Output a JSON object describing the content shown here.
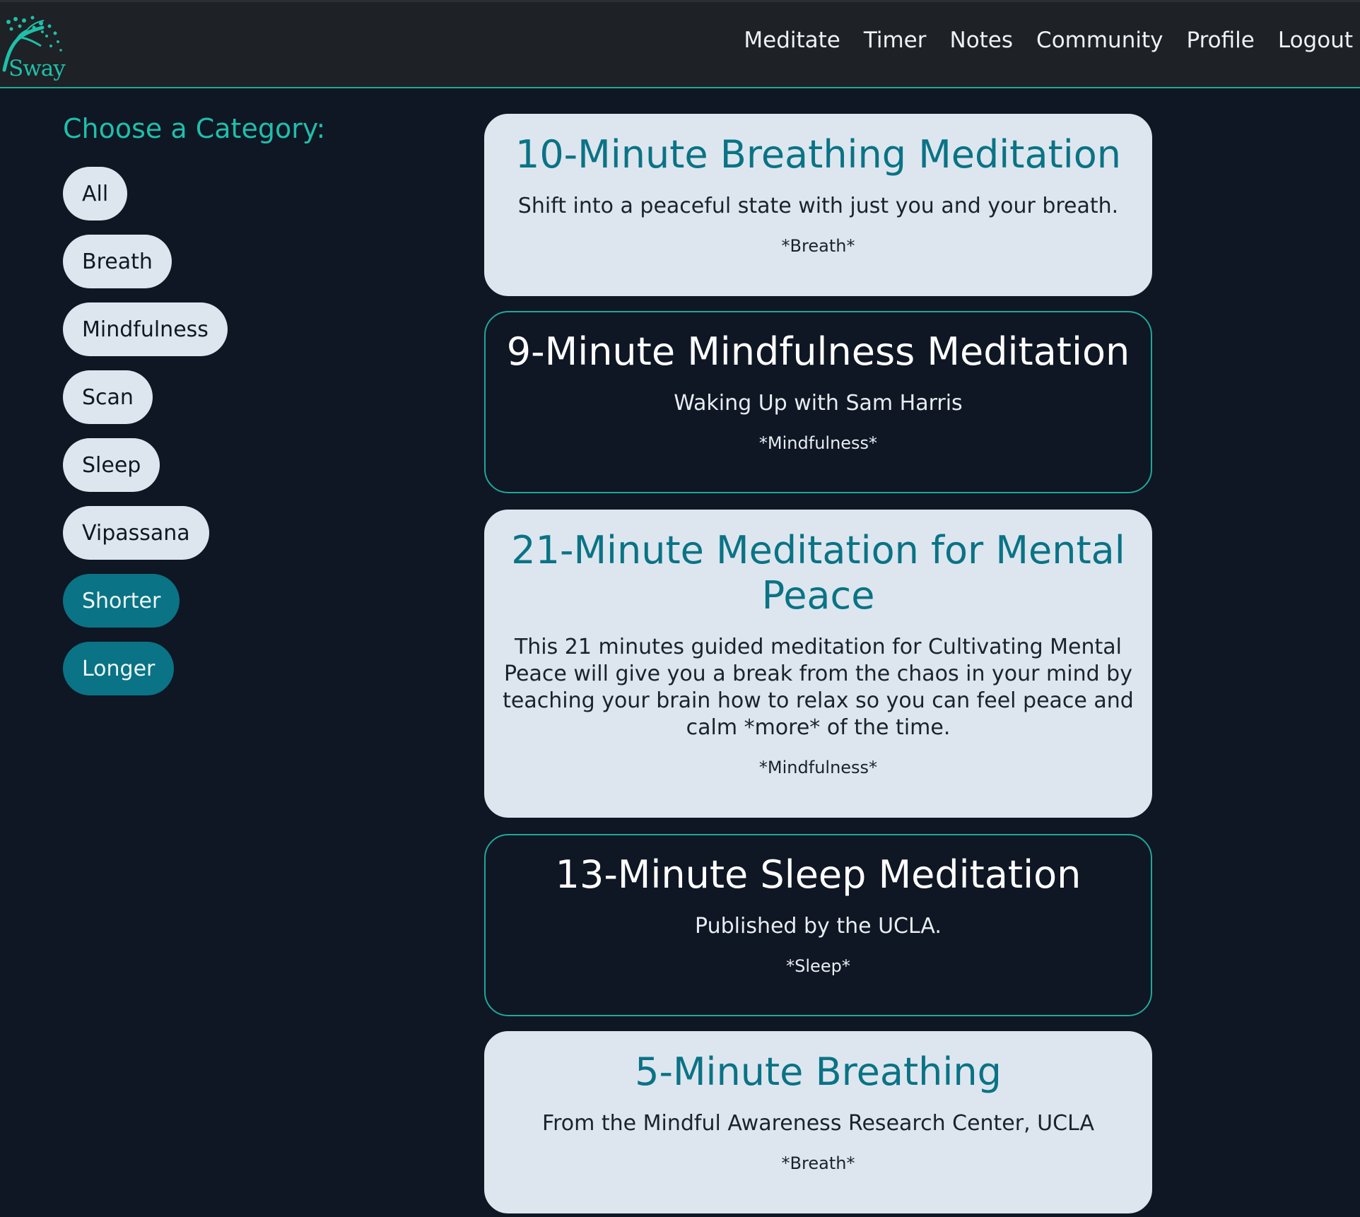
{
  "header": {
    "brand": "Sway",
    "nav": [
      "Meditate",
      "Timer",
      "Notes",
      "Community",
      "Profile",
      "Logout"
    ]
  },
  "sidebar": {
    "title": "Choose a Category:",
    "categories": [
      "All",
      "Breath",
      "Mindfulness",
      "Scan",
      "Sleep",
      "Vipassana",
      "Shorter",
      "Longer"
    ]
  },
  "meditations": [
    {
      "title": "10-Minute Breathing Meditation",
      "description": "Shift into a peaceful state with just you and your breath.",
      "tag": "*Breath*"
    },
    {
      "title": "9-Minute Mindfulness Meditation",
      "description": "Waking Up with Sam Harris",
      "tag": "*Mindfulness*"
    },
    {
      "title": "21-Minute Meditation for Mental Peace",
      "description": "This 21 minutes guided meditation for Cultivating Mental Peace will give you a break from the chaos in your mind by teaching your brain how to relax so you can feel peace and calm *more* of the time.",
      "tag": "*Mindfulness*"
    },
    {
      "title": "13-Minute Sleep Meditation",
      "description": "Published by the UCLA.",
      "tag": "*Sleep*"
    },
    {
      "title": "5-Minute Breathing",
      "description": "From the Mindful Awareness Research Center, UCLA",
      "tag": "*Breath*"
    }
  ],
  "colors": {
    "accent": "#1fbfaa",
    "button_dark": "#0a7385",
    "background": "#0f1624",
    "card_light": "#dde6ef"
  }
}
